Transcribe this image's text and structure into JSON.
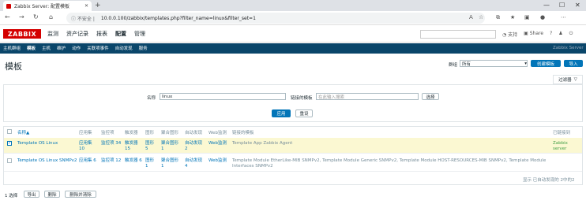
{
  "browser": {
    "tab_title": "Zabbix Server: 配置模板",
    "not_secure": "不安全",
    "url": "10.0.0.100/zabbix/templates.php?filter_name=linux&filter_set=1"
  },
  "header": {
    "logo": "ZABBIX",
    "menu": [
      "监测",
      "资产记录",
      "报表",
      "配置",
      "管理"
    ],
    "support": "支持",
    "share": "Share",
    "help": "?",
    "server_name": "Zabbix Server"
  },
  "submenu": [
    "主机群组",
    "模板",
    "主机",
    "维护",
    "动作",
    "关联项事件",
    "自动发现",
    "服务"
  ],
  "page": {
    "title": "模板",
    "group_label": "群组",
    "group_value": "所有",
    "create_button": "创建模板",
    "import_button": "导入",
    "filter_tab": "过滤器"
  },
  "filter": {
    "name_label": "名称",
    "name_value": "linux",
    "linked_label": "链接的模板",
    "linked_placeholder": "在此输入搜索",
    "select_button": "选择",
    "apply_button": "应用",
    "reset_button": "重设"
  },
  "table": {
    "headers": [
      "名称▲",
      "应用集",
      "监控项",
      "触发器",
      "图形",
      "聚合图形",
      "自动发现",
      "Web监测",
      "链接的模板",
      "已链接到"
    ],
    "rows": [
      {
        "checked": true,
        "name": "Template OS Linux",
        "apps": "应用集 10",
        "items": "监控项 34",
        "triggers": "触发器 15",
        "graphs": "图形 5",
        "screens": "聚合图形 1",
        "discovery": "自动发现 2",
        "web": "Web监测",
        "linked": "Template App Zabbix Agent",
        "linked_to": "Zabbix server"
      },
      {
        "checked": false,
        "name": "Template OS Linux SNMPv2",
        "apps": "应用集 6",
        "items": "监控项 12",
        "triggers": "触发器 6",
        "graphs": "图形 1",
        "screens": "聚合图形 1",
        "discovery": "自动发现 4",
        "web": "Web监测",
        "linked": "Template Module EtherLike-MIB SNMPv2, Template Module Generic SNMPv2, Template Module HOST-RESOURCES-MIB SNMPv2, Template Module Interfaces SNMPv2",
        "linked_to": ""
      }
    ],
    "footer": "显示 已自动发现的 2中的2"
  },
  "bottom": {
    "selected": "1 选择",
    "export": "导出",
    "delete": "删除",
    "delete_clear": "删除并清除"
  },
  "colors": {
    "brand": "#d40000",
    "subnav": "#0a466a",
    "link": "#0275b8",
    "highlight_row": "#fbf8d2",
    "linked_to": "#429e47"
  }
}
